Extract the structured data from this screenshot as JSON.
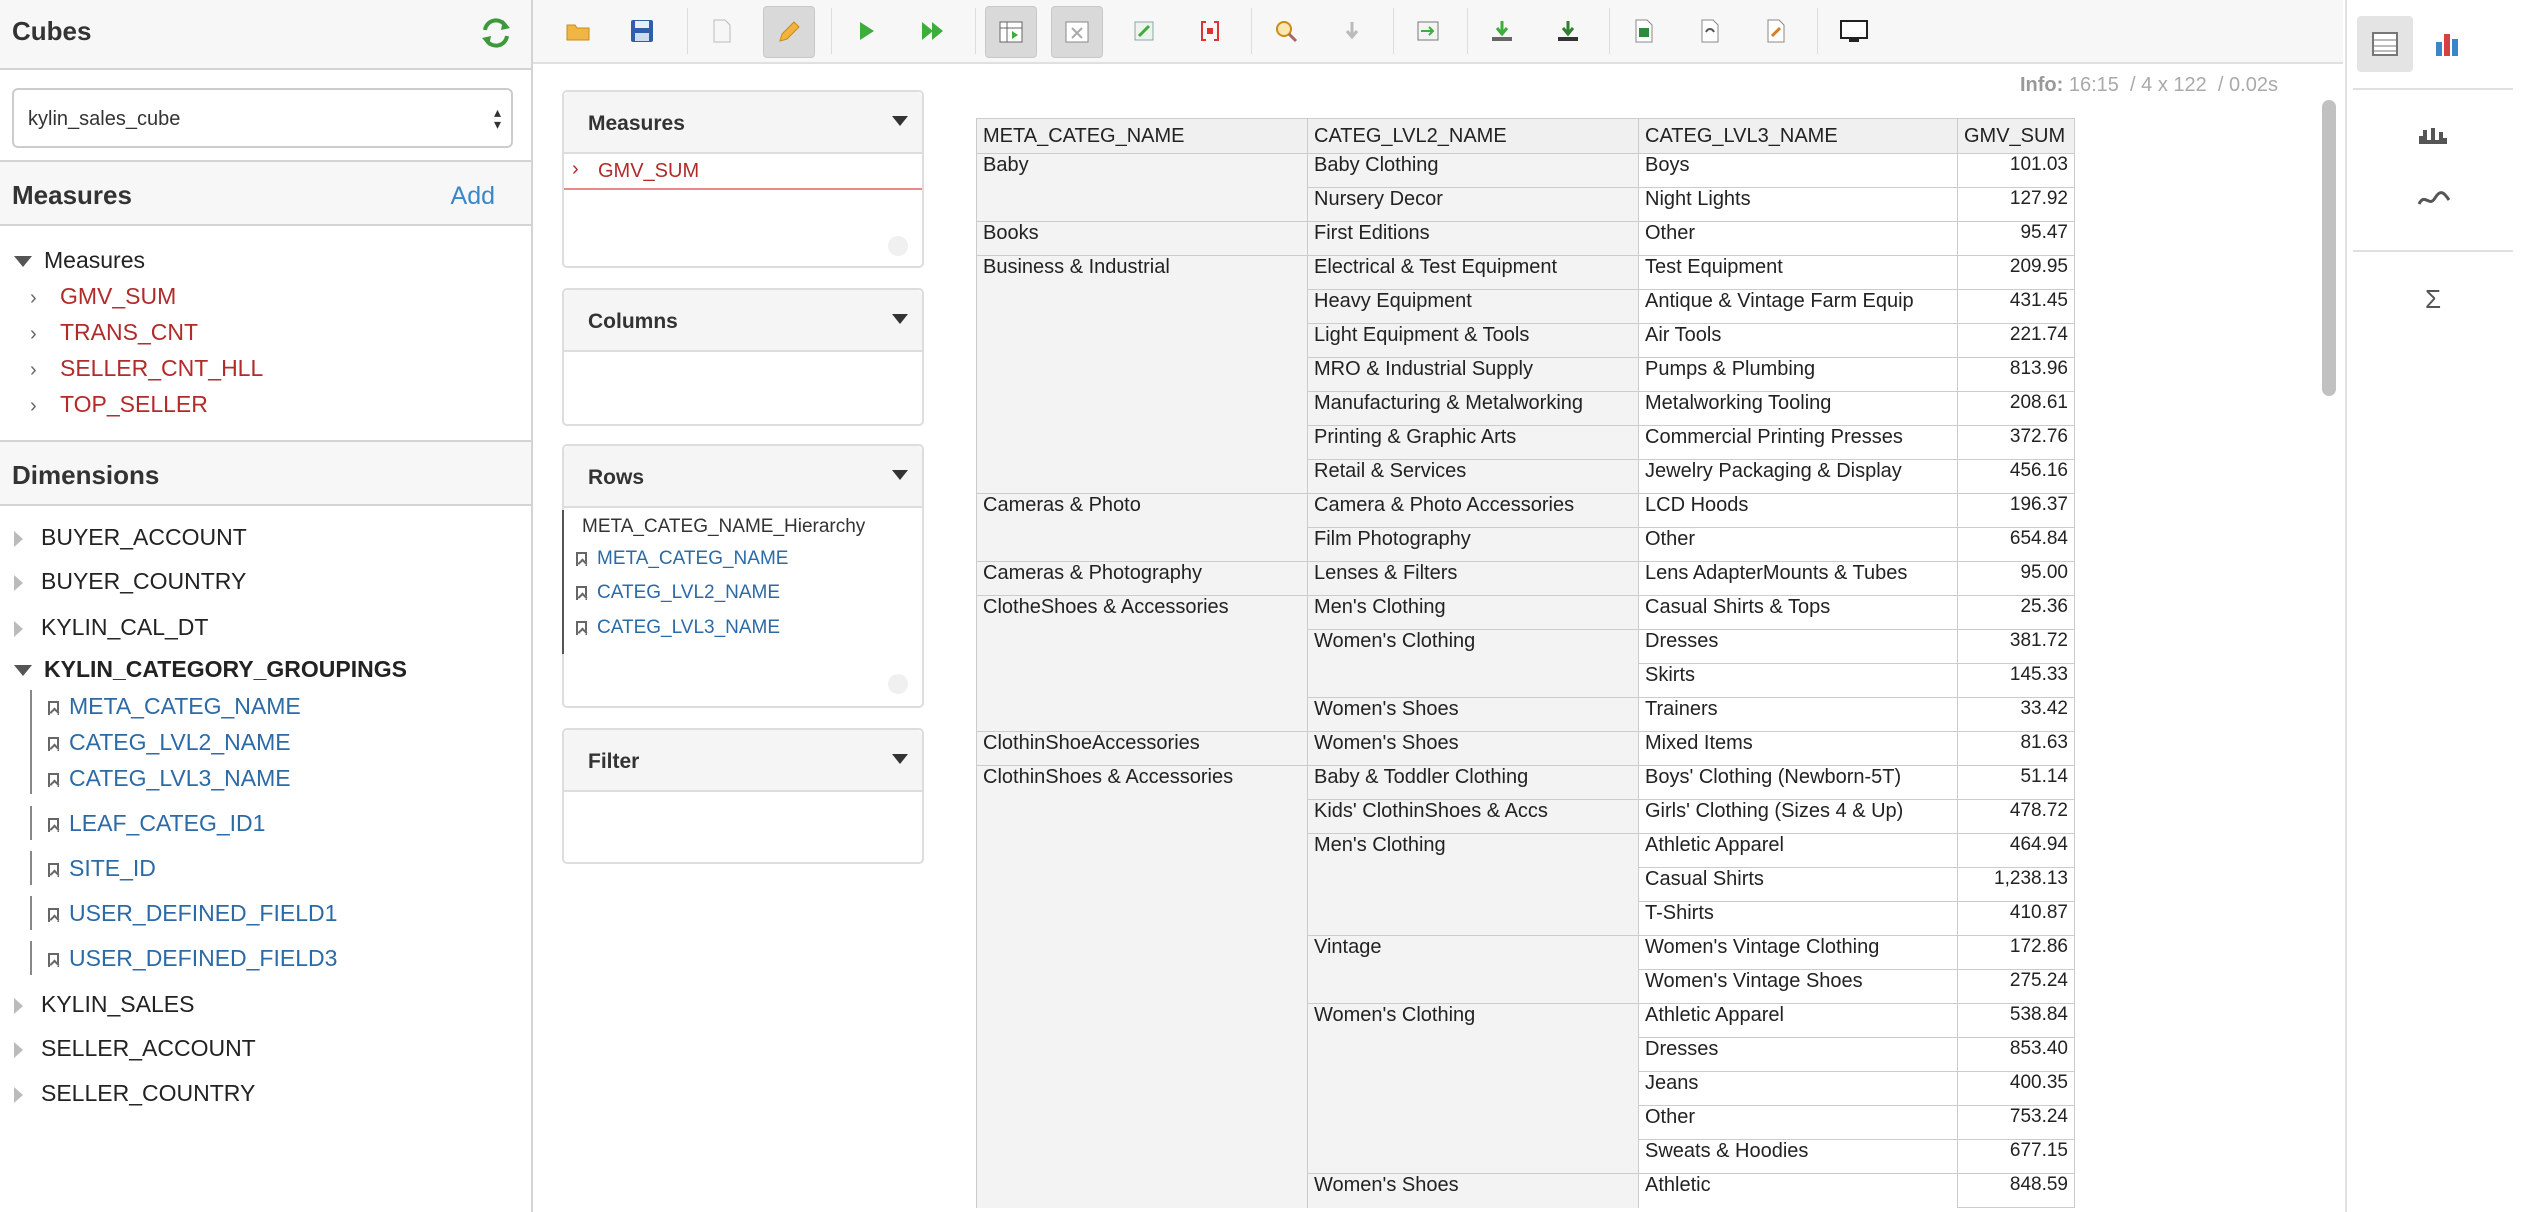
{
  "sidebar": {
    "cubes_title": "Cubes",
    "cube_selected": "kylin_sales_cube",
    "measures_title": "Measures",
    "add_label": "Add",
    "measures_folder": "Measures",
    "measures": [
      "GMV_SUM",
      "TRANS_CNT",
      "SELLER_CNT_HLL",
      "TOP_SELLER"
    ],
    "dimensions_title": "Dimensions",
    "dimensions_top": [
      "BUYER_ACCOUNT",
      "BUYER_COUNTRY",
      "KYLIN_CAL_DT"
    ],
    "expanded_dimension": "KYLIN_CATEGORY_GROUPINGS",
    "hierarchy_levels": [
      "META_CATEG_NAME",
      "CATEG_LVL2_NAME",
      "CATEG_LVL3_NAME"
    ],
    "single_levels": [
      "LEAF_CATEG_ID1",
      "SITE_ID",
      "USER_DEFINED_FIELD1",
      "USER_DEFINED_FIELD3"
    ],
    "dimensions_bottom": [
      "KYLIN_SALES",
      "SELLER_ACCOUNT",
      "SELLER_COUNTRY"
    ]
  },
  "info": {
    "label": "Info:",
    "time": "16:15",
    "dims": "4 x 122",
    "duration": "0.02s"
  },
  "query": {
    "measures_title": "Measures",
    "measure_item": "GMV_SUM",
    "columns_title": "Columns",
    "rows_title": "Rows",
    "rows_hierarchy": "META_CATEG_NAME_Hierarchy",
    "rows_levels": [
      "META_CATEG_NAME",
      "CATEG_LVL2_NAME",
      "CATEG_LVL3_NAME"
    ],
    "filter_title": "Filter"
  },
  "table": {
    "headers": [
      "META_CATEG_NAME",
      "CATEG_LVL2_NAME",
      "CATEG_LVL3_NAME",
      "GMV_SUM"
    ],
    "rows": [
      [
        "Baby",
        "Baby Clothing",
        "Boys",
        "101.03"
      ],
      [
        "",
        "Nursery Decor",
        "Night Lights",
        "127.92"
      ],
      [
        "Books",
        "First Editions",
        "Other",
        "95.47"
      ],
      [
        "Business & Industrial",
        "Electrical & Test Equipment",
        "Test Equipment",
        "209.95"
      ],
      [
        "",
        "Heavy Equipment",
        "Antique & Vintage Farm Equip",
        "431.45"
      ],
      [
        "",
        "Light Equipment & Tools",
        "Air Tools",
        "221.74"
      ],
      [
        "",
        "MRO & Industrial Supply",
        "Pumps & Plumbing",
        "813.96"
      ],
      [
        "",
        "Manufacturing & Metalworking",
        "Metalworking Tooling",
        "208.61"
      ],
      [
        "",
        "Printing & Graphic Arts",
        "Commercial Printing Presses",
        "372.76"
      ],
      [
        "",
        "Retail & Services",
        "Jewelry Packaging & Display",
        "456.16"
      ],
      [
        "Cameras & Photo",
        "Camera & Photo Accessories",
        "LCD Hoods",
        "196.37"
      ],
      [
        "",
        "Film Photography",
        "Other",
        "654.84"
      ],
      [
        "Cameras & Photography",
        "Lenses & Filters",
        "Lens AdapterMounts & Tubes",
        "95.00"
      ],
      [
        "ClotheShoes & Accessories",
        "Men's Clothing",
        "Casual Shirts & Tops",
        "25.36"
      ],
      [
        "",
        "Women's Clothing",
        "Dresses",
        "381.72"
      ],
      [
        "",
        "",
        "Skirts",
        "145.33"
      ],
      [
        "",
        "Women's Shoes",
        "Trainers",
        "33.42"
      ],
      [
        "ClothinShoeAccessories",
        "Women's Shoes",
        "Mixed Items",
        "81.63"
      ],
      [
        "ClothinShoes & Accessories",
        "Baby & Toddler Clothing",
        "Boys' Clothing (Newborn-5T)",
        "51.14"
      ],
      [
        "",
        "Kids' ClothinShoes & Accs",
        "Girls' Clothing (Sizes 4 & Up)",
        "478.72"
      ],
      [
        "",
        "Men's Clothing",
        "Athletic Apparel",
        "464.94"
      ],
      [
        "",
        "",
        "Casual Shirts",
        "1,238.13"
      ],
      [
        "",
        "",
        "T-Shirts",
        "410.87"
      ],
      [
        "",
        "Vintage",
        "Women's Vintage Clothing",
        "172.86"
      ],
      [
        "",
        "",
        "Women's Vintage Shoes",
        "275.24"
      ],
      [
        "",
        "Women's Clothing",
        "Athletic Apparel",
        "538.84"
      ],
      [
        "",
        "",
        "Dresses",
        "853.40"
      ],
      [
        "",
        "",
        "Jeans",
        "400.35"
      ],
      [
        "",
        "",
        "Other",
        "753.24"
      ],
      [
        "",
        "",
        "Sweats & Hoodies",
        "677.15"
      ],
      [
        "",
        "Women's Shoes",
        "Athletic",
        "848.59"
      ]
    ]
  },
  "colors": {
    "measure": "#b22b2b",
    "level": "#2b6aa6",
    "link": "#3a87c8"
  }
}
